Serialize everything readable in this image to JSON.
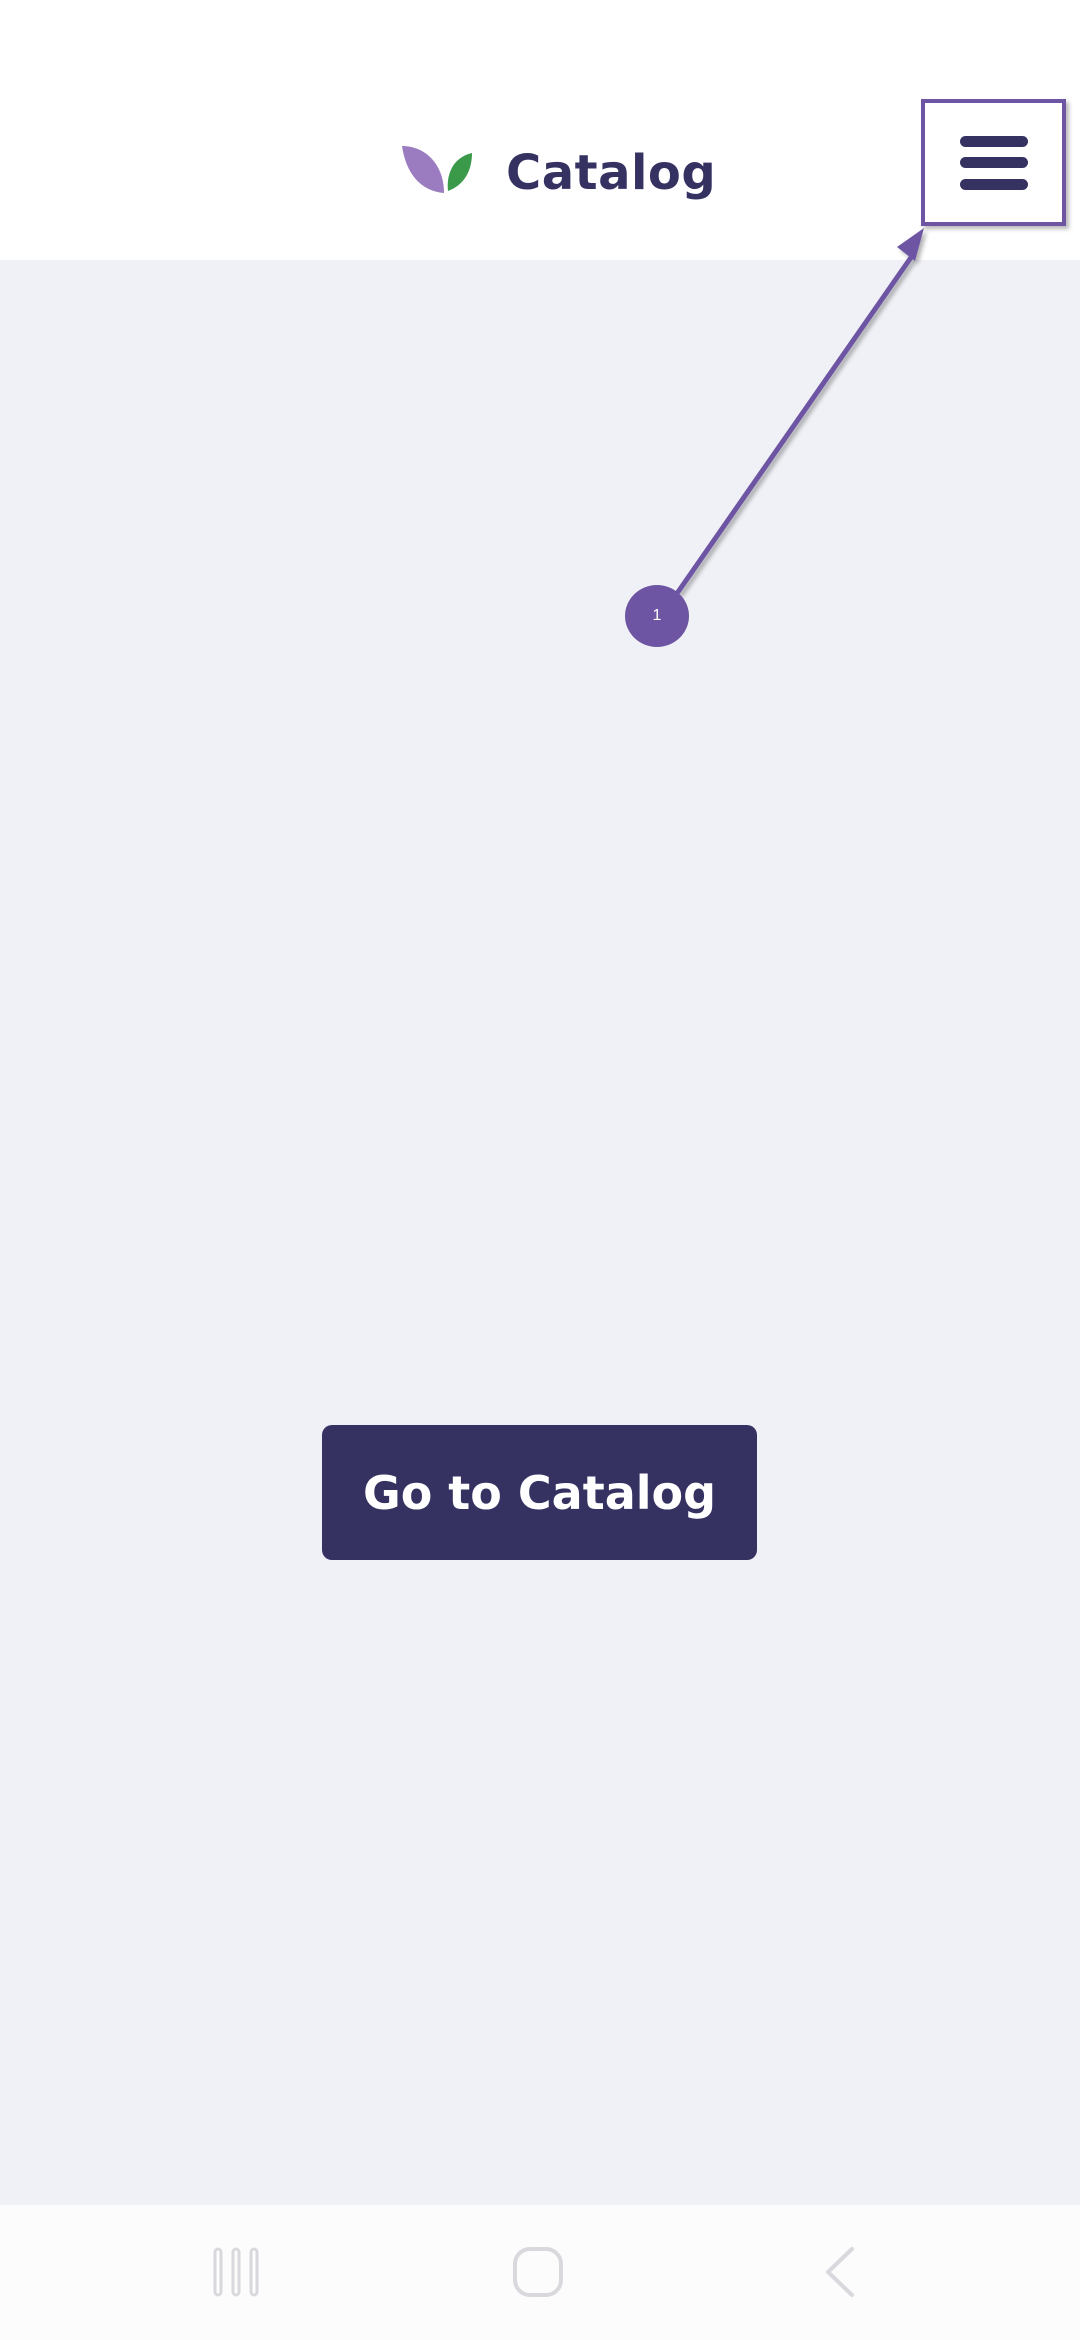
{
  "header": {
    "app_name": "Catalog",
    "logo_icon": "leaf-logo-icon",
    "menu_icon": "hamburger-menu-icon"
  },
  "main": {
    "cta_label": "Go to Catalog"
  },
  "annotation": {
    "marker_label": "1",
    "color": "#6d55a3"
  },
  "system_nav": {
    "recent_icon": "recent-apps-icon",
    "home_icon": "home-icon",
    "back_icon": "back-icon"
  },
  "colors": {
    "primary": "#353262",
    "accent": "#6d55a3",
    "leaf_purple": "#9b7cc0",
    "leaf_green": "#3a9a4a",
    "background": "#f0f1f6"
  }
}
